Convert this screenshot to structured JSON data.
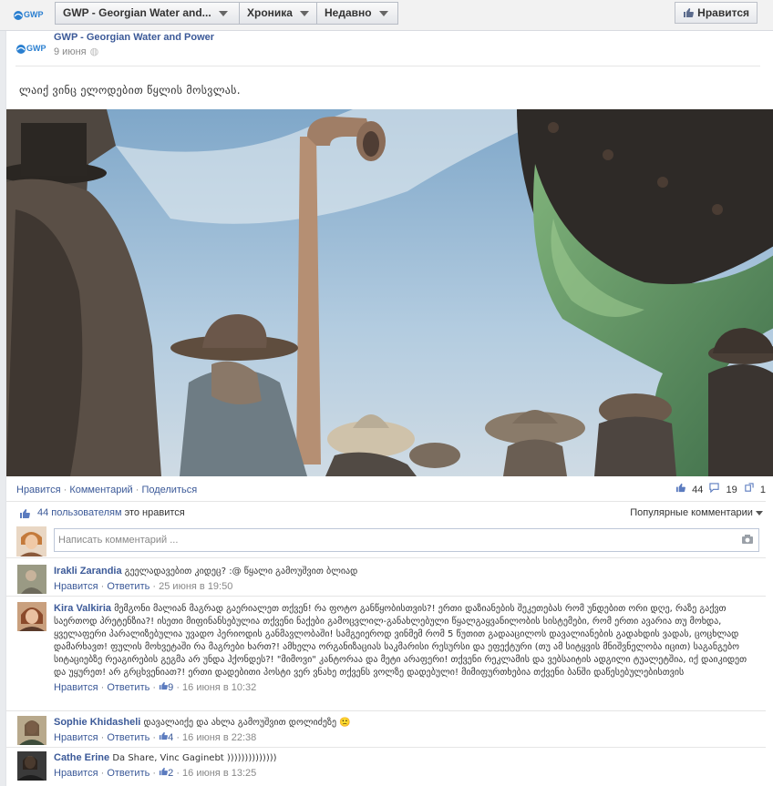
{
  "topbar": {
    "page_name": "GWP - Georgian Water and...",
    "timeline": "Хроника",
    "recent": "Недавно",
    "like_button": "Нравится"
  },
  "logo_text": "GWP",
  "post": {
    "author": "GWP - Georgian Water and Power",
    "date": "9 июня",
    "text": "ლაიქ ვინც ელოდებით წყლის მოსვლას.",
    "actions": {
      "like": "Нравится",
      "comment": "Комментарий",
      "share": "Поделиться"
    },
    "stats": {
      "likes": "44",
      "comments": "19",
      "shares": "1"
    },
    "likes_count": "44 пользователям",
    "likes_suffix": "это нравится",
    "popular": "Популярные комментарии",
    "comment_placeholder": "Написать комментарий ..."
  },
  "comments": [
    {
      "name": "Irakli Zarandia",
      "text": "გეელადავებით კიდეც? :@ წყალი გამოუშვით ბლიად",
      "like": "Нравится",
      "reply": "Ответить",
      "likes": "",
      "time": "25 июня в 19:50"
    },
    {
      "name": "Kira Valkiria",
      "text": "მემგონი მალიან მაგრად გაერიალეთ თქვენ! რა ფოტო განწყობისთვის?! ერთი დაზიანების შეკეთებას რომ უნდებით ორი დღე, რაზე გაქვთ საერთოდ პრეტენზია?! ისეთი მიფინანსებულია თქვენი ნაქები გამოცვლილ-განახლებული წყალგაყვანილობის სისტემები, რომ ერთი ავარია თუ მოხდა, ყველაფერი პარალიზებულია უვადო პერიოდის განმავლობაში! სამგეიეროდ ვინმემ რომ 5 წუთით გადააცილოს დავალიანების გადახდის ვადას, ცოცხლად დამარხავთ! ფულის მოხვეტაში რა მაგრები ხართ?! ამხელა ორგანიზაციას საკმარისი რესურსი და ეფექტური (თუ ამ სიტყვის მნიშვნელობა იცით) საგანგებო სიტაციებზე რეაგირების გეგმა არ უნდა ჰქონდეს?! \"მიმოვი\" კანტორაა და მეტი არაფერი! თქვენი რეკლამის და ვებსაიტის ადგილი ტუალეტშია, იქ დაიკიდეთ და უყურეთ! არ გრცხვენიათ?! ერთი დადებითი პოსტი ვერ ვნახე თქვენს ვოლზე დადებული! მიმიფურთხებია თქვენი ბანში დაწესებულებისთვის",
      "like": "Нравится",
      "reply": "Ответить",
      "likes": "9",
      "time": "16 июня в 10:32"
    },
    {
      "name": "Sophie Khidasheli",
      "text": "დავალაიქე და ახლა გამოუშვით დოლიძეზე 🙁",
      "like": "Нравится",
      "reply": "Ответить",
      "likes": "4",
      "time": "16 июня в 22:38"
    },
    {
      "name": "Cathe Erine",
      "text": "Da Share, Vinc Gaginebt ))))))))))))))",
      "like": "Нравится",
      "reply": "Ответить",
      "likes": "2",
      "time": "16 июня в 13:25"
    }
  ]
}
